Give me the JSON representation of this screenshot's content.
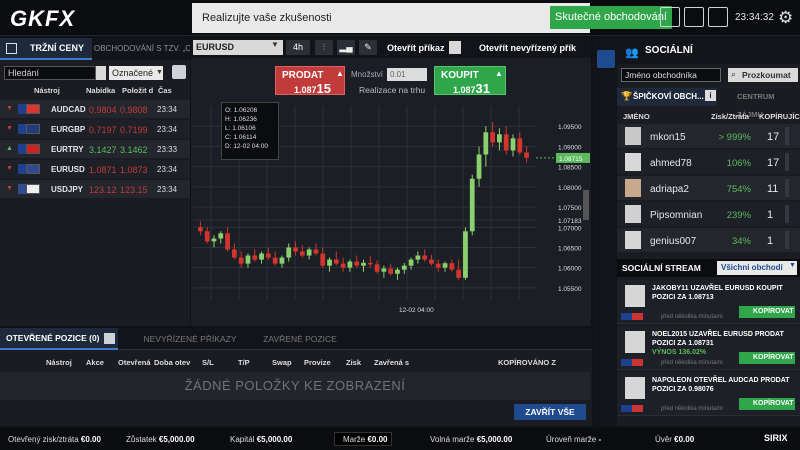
{
  "brand": {
    "logo": "GKFX"
  },
  "banner": {
    "text": "Realizujte vaše zkušenosti",
    "button": "Skutečné obchodování"
  },
  "topbar": {
    "time": "23:34:32"
  },
  "left_panel": {
    "tabs": [
      "TRŽNÍ CENY",
      "OBCHODOVÁNÍ S TZV. „CL"
    ],
    "search_placeholder": "Hledání",
    "filter": "Označené",
    "columns": [
      "Nástroj",
      "Nabídka",
      "Položit d",
      "Čas"
    ],
    "rows": [
      {
        "dir": "down",
        "symbol": "AUDCAD",
        "bid": "0.9804",
        "ask": "0.9808",
        "time": "23:34",
        "color": "#c53a3a"
      },
      {
        "dir": "down",
        "symbol": "EURGBP",
        "bid": "0.7197",
        "ask": "0.7199",
        "time": "23:34",
        "color": "#c53a3a"
      },
      {
        "dir": "up",
        "symbol": "EURTRY",
        "bid": "3.1427",
        "ask": "3.1462",
        "time": "23:33",
        "color": "#5dbb5d"
      },
      {
        "dir": "down",
        "symbol": "EURUSD",
        "bid": "1.0871",
        "ask": "1.0873",
        "time": "23:34",
        "color": "#c53a3a"
      },
      {
        "dir": "down",
        "symbol": "USDJPY",
        "bid": "123.12",
        "ask": "123.15",
        "time": "23:34",
        "color": "#c53a3a"
      }
    ]
  },
  "chart_panel": {
    "symbol": "EURUSD",
    "timeframe": "4h",
    "open_order": "Otevřít příkaz",
    "pending_order": "Otevřít nevyřízený přík",
    "sell": {
      "label": "PRODAT",
      "price_main": "1.087",
      "price_big": "15"
    },
    "buy": {
      "label": "KOUPIT",
      "price_main": "1.087",
      "price_big": "31"
    },
    "qty_label": "Množství",
    "qty_placeholder": "0.01",
    "execution": "Realizace na trhu",
    "tooltip": {
      "o": "1.06206",
      "h": "1.06236",
      "l": "1.06106",
      "c": "1.06114",
      "d": "12-02 04:00"
    },
    "tooltip_labels": {
      "o": "O:",
      "h": "H:",
      "l": "L:",
      "c": "C:",
      "d": "D:"
    }
  },
  "chart_data": {
    "type": "candlestick",
    "x_label_marker": "12-02 04:00",
    "y_ticks": [
      "1.09500",
      "1.09000",
      "1.08500",
      "1.08000",
      "1.07500",
      "1.07183",
      "1.07000",
      "1.06500",
      "1.06000",
      "1.05500"
    ],
    "current_price": "1.08715",
    "ylim": [
      1.052,
      1.1
    ],
    "candles": [
      [
        1.07,
        1.0715,
        1.068,
        1.069
      ],
      [
        1.069,
        1.07,
        1.066,
        1.0665
      ],
      [
        1.0665,
        1.068,
        1.065,
        1.0672
      ],
      [
        1.0672,
        1.069,
        1.066,
        1.0685
      ],
      [
        1.0685,
        1.07,
        1.064,
        1.0645
      ],
      [
        1.0645,
        1.066,
        1.062,
        1.0625
      ],
      [
        1.0625,
        1.064,
        1.06,
        1.061
      ],
      [
        1.061,
        1.0635,
        1.06,
        1.063
      ],
      [
        1.063,
        1.0645,
        1.0615,
        1.062
      ],
      [
        1.062,
        1.064,
        1.061,
        1.0635
      ],
      [
        1.0635,
        1.065,
        1.062,
        1.0625
      ],
      [
        1.0625,
        1.064,
        1.0605,
        1.061
      ],
      [
        1.061,
        1.063,
        1.06,
        1.0625
      ],
      [
        1.0625,
        1.066,
        1.0615,
        1.065
      ],
      [
        1.065,
        1.0665,
        1.063,
        1.064
      ],
      [
        1.064,
        1.0655,
        1.0625,
        1.063
      ],
      [
        1.063,
        1.065,
        1.062,
        1.0645
      ],
      [
        1.0645,
        1.066,
        1.063,
        1.0635
      ],
      [
        1.0635,
        1.065,
        1.06,
        1.0605
      ],
      [
        1.0605,
        1.0625,
        1.059,
        1.062
      ],
      [
        1.062,
        1.064,
        1.0605,
        1.061
      ],
      [
        1.061,
        1.0625,
        1.059,
        1.06
      ],
      [
        1.06,
        1.062,
        1.059,
        1.0615
      ],
      [
        1.0615,
        1.063,
        1.06,
        1.0605
      ],
      [
        1.0605,
        1.062,
        1.059,
        1.0612
      ],
      [
        1.0612,
        1.0628,
        1.06,
        1.0608
      ],
      [
        1.0608,
        1.0618,
        1.0585,
        1.059
      ],
      [
        1.059,
        1.0605,
        1.0575,
        1.0598
      ],
      [
        1.0598,
        1.061,
        1.058,
        1.0585
      ],
      [
        1.0585,
        1.06,
        1.057,
        1.0595
      ],
      [
        1.0595,
        1.0612,
        1.0585,
        1.0605
      ],
      [
        1.0605,
        1.0625,
        1.0595,
        1.062
      ],
      [
        1.062,
        1.064,
        1.061,
        1.063
      ],
      [
        1.063,
        1.0645,
        1.0615,
        1.062
      ],
      [
        1.062,
        1.0632,
        1.0605,
        1.061
      ],
      [
        1.061,
        1.062,
        1.059,
        1.06
      ],
      [
        1.06,
        1.0615,
        1.059,
        1.0611
      ],
      [
        1.0611,
        1.062,
        1.059,
        1.0595
      ],
      [
        1.0595,
        1.062,
        1.057,
        1.0575
      ],
      [
        1.0575,
        1.07,
        1.057,
        1.069
      ],
      [
        1.069,
        1.083,
        1.068,
        1.082
      ],
      [
        1.082,
        1.09,
        1.08,
        1.088
      ],
      [
        1.088,
        1.095,
        1.085,
        1.0935
      ],
      [
        1.0935,
        1.096,
        1.09,
        1.091
      ],
      [
        1.091,
        1.0945,
        1.089,
        1.093
      ],
      [
        1.093,
        1.095,
        1.088,
        1.089
      ],
      [
        1.089,
        1.093,
        1.0875,
        1.092
      ],
      [
        1.092,
        1.0935,
        1.088,
        1.0885
      ],
      [
        1.0885,
        1.09,
        1.086,
        1.0872
      ]
    ]
  },
  "positions": {
    "tabs": [
      "OTEVŘENÉ POZICE (0)",
      "NEVYŘÍZENÉ PŘÍKAZY",
      "ZAVŘENÉ POZICE"
    ],
    "columns": [
      "Nástroj",
      "Akce",
      "Otevřená",
      "Doba otev",
      "S/L",
      "T/P",
      "Swap",
      "Provize",
      "Zisk",
      "Zavřená s",
      "KOPÍROVÁNO Z"
    ],
    "empty": "ŽÁDNÉ POLOŽKY KE ZOBRAZENÍ",
    "close_all": "ZAVŘÍT VŠE"
  },
  "status_bar": [
    {
      "label": "Otevřený zisk/ztráta",
      "value": "€0.00"
    },
    {
      "label": "Zůstatek",
      "value": "€5,000.00"
    },
    {
      "label": "Kapitál",
      "value": "€5,000.00"
    },
    {
      "label": "Marže",
      "value": "€0.00"
    },
    {
      "label": "Volná marže",
      "value": "€5,000.00"
    },
    {
      "label": "Úroveň marže",
      "value": "-"
    },
    {
      "label": "Úvěr",
      "value": "€0.00"
    }
  ],
  "social": {
    "title": "SOCIÁLNÍ",
    "search_placeholder": "Jméno obchodníka",
    "search_button": "Prozkoumat",
    "tabs": [
      "ŠPIČKOVÍ OBCH...",
      "CENTRUM ZÁJMU"
    ],
    "info": "i",
    "columns": [
      "JMÉNO",
      "Zisk/Ztráta",
      "KOPÍRUJÍC"
    ],
    "traders": [
      {
        "name": "mkon15",
        "pct": "> 999%",
        "copiers": "17"
      },
      {
        "name": "ahmed78",
        "pct": "106%",
        "copiers": "17"
      },
      {
        "name": "adriapa2",
        "pct": "754%",
        "copiers": "11"
      },
      {
        "name": "Pipsomnian",
        "pct": "239%",
        "copiers": "1"
      },
      {
        "name": "genius007",
        "pct": "34%",
        "copiers": "1"
      }
    ],
    "stream_title": "SOCIÁLNÍ STREAM",
    "stream_filter": "Všichni obchodí",
    "stream": [
      {
        "text": "JAKOBY11 UZAVŘEL EURUSD KOUPIT POZICI ZA 1.08713",
        "ago": "před několika minutami",
        "copy": "KOPÍROVAT"
      },
      {
        "text": "NOEL2015 UZAVŘEL EURUSD PRODAT POZICI ZA 1.08731",
        "gain": "VÝNOS 136.02%",
        "ago": "před několika minutami",
        "copy": "KOPÍROVAT"
      },
      {
        "text": "NAPOLEON OTEVŘEL AUDCAD PRODAT POZICI ZA 0.98076",
        "ago": "před několika minutami",
        "copy": "KOPÍROVAT"
      }
    ]
  },
  "footer_brand": "SIRIX",
  "colors": {
    "buy": "#2fa64a",
    "sell": "#c23b3b",
    "accent": "#1e4a8f"
  }
}
